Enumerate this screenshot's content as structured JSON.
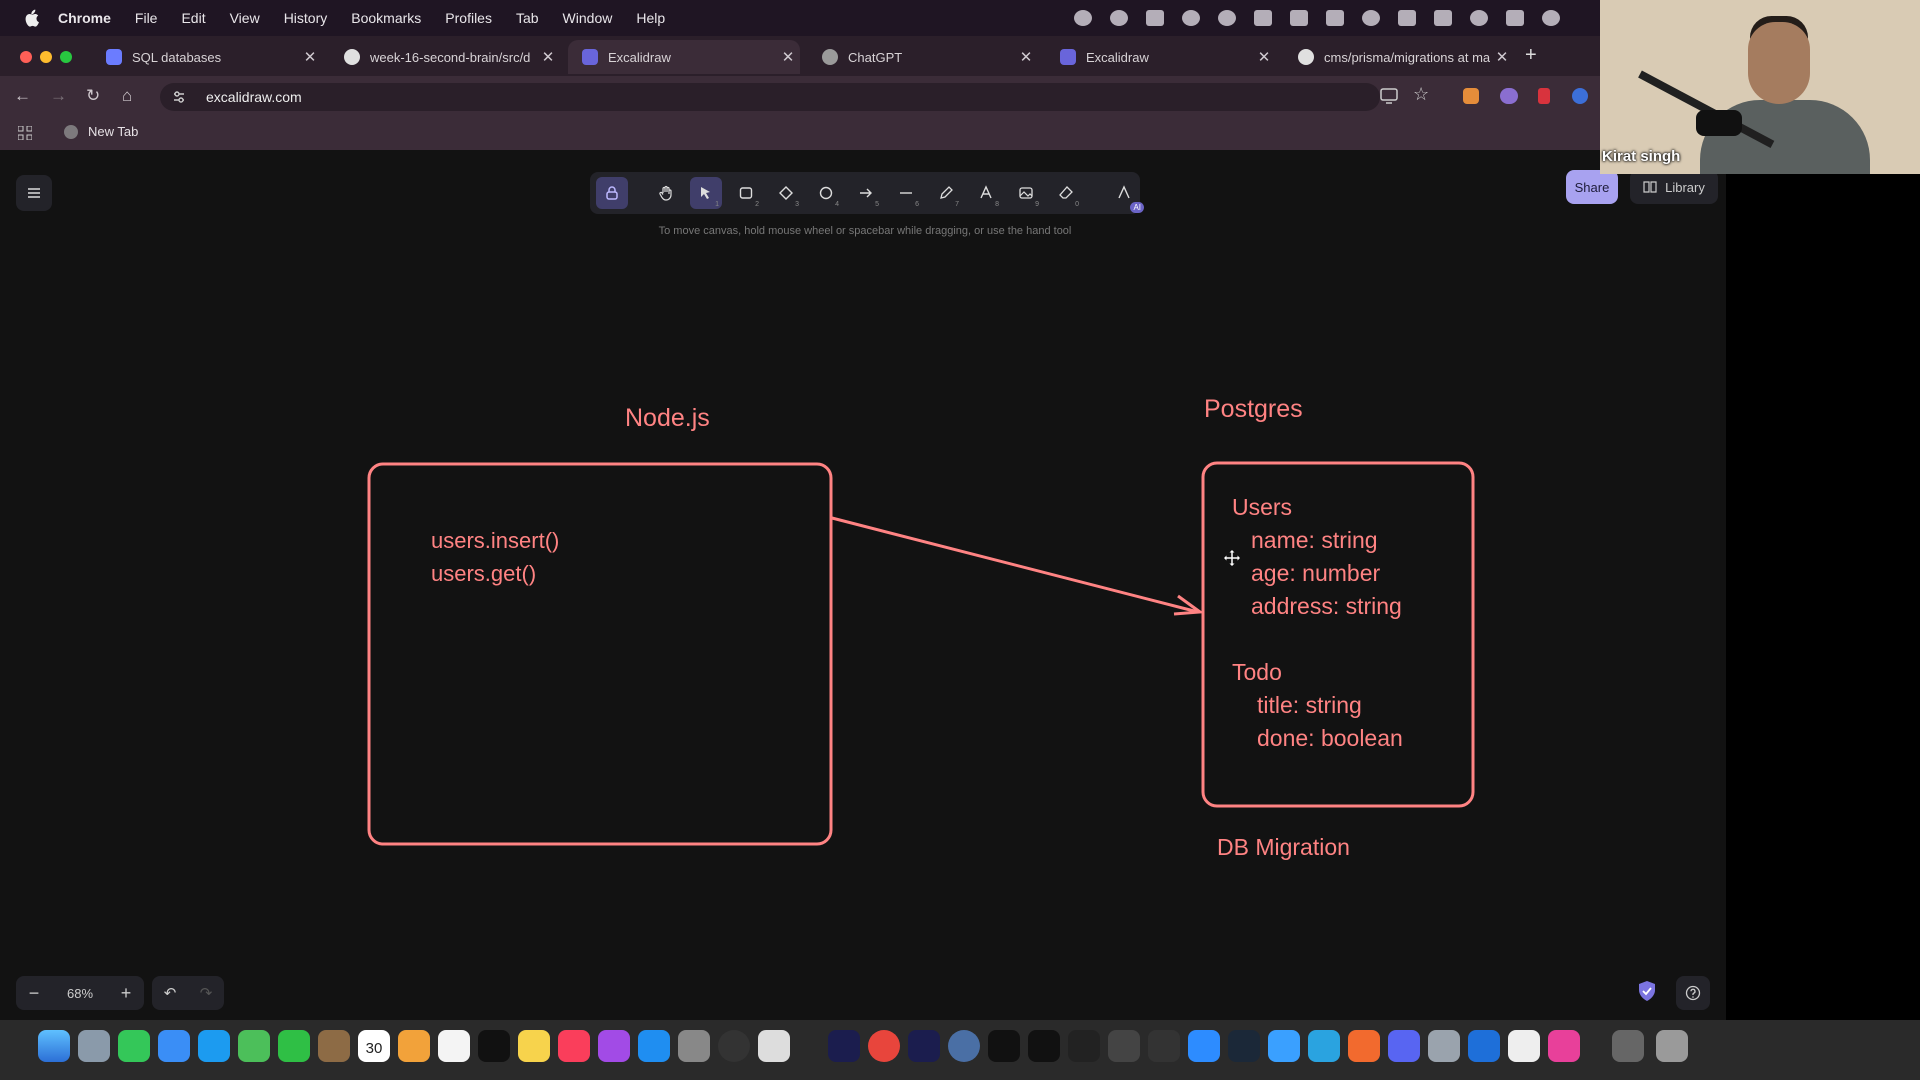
{
  "menubar": {
    "app": "Chrome",
    "items": [
      "File",
      "Edit",
      "View",
      "History",
      "Bookmarks",
      "Profiles",
      "Tab",
      "Window",
      "Help"
    ]
  },
  "tabs": [
    {
      "label": "SQL databases",
      "color": "#6b7cff",
      "active": false
    },
    {
      "label": "week-16-second-brain/src/d",
      "color": "#e0e0e0",
      "active": false
    },
    {
      "label": "Excalidraw",
      "color": "#6965db",
      "active": true
    },
    {
      "label": "ChatGPT",
      "color": "#9a9a9a",
      "active": false
    },
    {
      "label": "Excalidraw",
      "color": "#6965db",
      "active": false
    },
    {
      "label": "cms/prisma/migrations at ma",
      "color": "#e0e0e0",
      "active": false
    }
  ],
  "address_bar": {
    "url": "excalidraw.com"
  },
  "bookmarks": {
    "new_tab": "New Tab"
  },
  "excalidraw": {
    "tools": [
      {
        "icon": "lock-icon",
        "key": ""
      },
      {
        "icon": "hand-icon",
        "key": ""
      },
      {
        "icon": "selection-arrow-icon",
        "key": "1"
      },
      {
        "icon": "rectangle-icon",
        "key": "2"
      },
      {
        "icon": "diamond-icon",
        "key": "3"
      },
      {
        "icon": "ellipse-icon",
        "key": "4"
      },
      {
        "icon": "arrow-icon",
        "key": "5"
      },
      {
        "icon": "line-icon",
        "key": "6"
      },
      {
        "icon": "pencil-icon",
        "key": "7"
      },
      {
        "icon": "text-icon",
        "key": "8"
      },
      {
        "icon": "image-icon",
        "key": "9"
      },
      {
        "icon": "eraser-icon",
        "key": "0"
      },
      {
        "icon": "more-tools-icon",
        "key": ""
      }
    ],
    "hint": "To move canvas, hold mouse wheel or spacebar while dragging, or use the hand tool",
    "share": "Share",
    "library": "Library",
    "zoom": "68%"
  },
  "diagram": {
    "stroke_color": "#ff8383",
    "node_title": "Node.js",
    "node_code": [
      "users.insert()",
      "users.get()"
    ],
    "pg_title": "Postgres",
    "users_heading": "Users",
    "users_fields": [
      "name: string",
      "age: number",
      "address: string"
    ],
    "todo_heading": "Todo",
    "todo_fields": [
      "title: string",
      "done: boolean"
    ],
    "migration_label": "DB Migration"
  },
  "webcam": {
    "name": "Kirat singh"
  },
  "dock": {
    "calendar_day": "30"
  }
}
